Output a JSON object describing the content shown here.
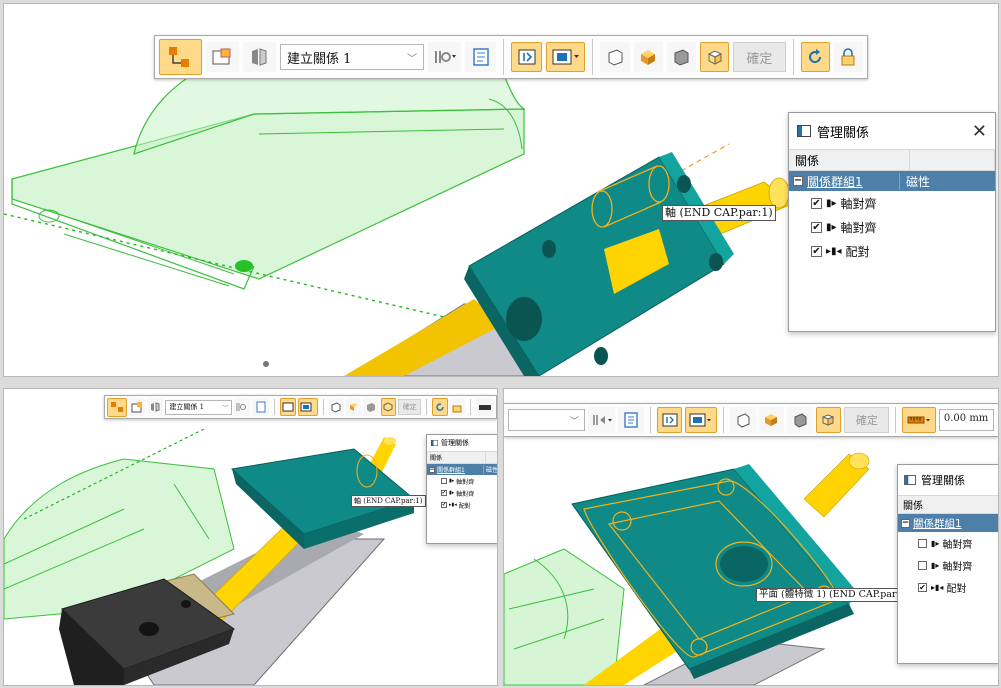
{
  "toolbar": {
    "relationship_combo": "建立關係 1",
    "ok_label": "確定",
    "offset_value": "0.00 mm"
  },
  "relation_panel": {
    "title": "管理關係",
    "column_relation": "關係",
    "group_name": "關係群組1",
    "group_value": "磁性",
    "group_value_short": "磁性",
    "items": [
      {
        "label": "軸對齊"
      },
      {
        "label": "軸對齊"
      },
      {
        "label": "配對"
      }
    ]
  },
  "panels": {
    "top": {
      "items_checked": [
        true,
        true,
        true
      ]
    },
    "bottom_left": {
      "items_checked": [
        false,
        true,
        true
      ]
    },
    "bottom_right": {
      "items_checked": [
        false,
        false,
        true
      ]
    }
  },
  "tooltips": {
    "axis": "軸 (END CAP.par:1)",
    "plane": "平面 (體特徵 1) (END CAP.par:1)"
  },
  "icons": {
    "close": "close-icon",
    "panel": "panel-icon",
    "expand": "collapse-minus-icon",
    "align": "axial-align-icon",
    "mate": "mate-icon",
    "dropdown": "chevron-down-icon"
  },
  "colors": {
    "teal_part": "#0f8a86",
    "yellow_shaft": "#ffd400",
    "green_ghost": "#9fe39f",
    "selection_blue": "#4d7fa8",
    "active_button": "#ffd98a",
    "dark_part": "#2f2f2f",
    "grey_rail": "#b7b7bd"
  }
}
